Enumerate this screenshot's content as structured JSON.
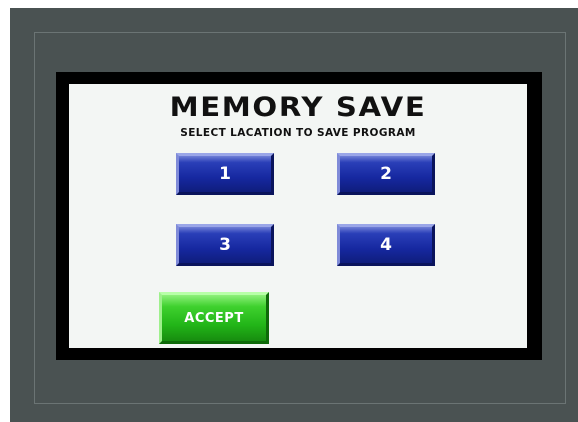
{
  "screen": {
    "title": "MEMORY SAVE",
    "subtitle": "SELECT LACATION TO SAVE PROGRAM"
  },
  "slots": [
    {
      "label": "1"
    },
    {
      "label": "2"
    },
    {
      "label": "3"
    },
    {
      "label": "4"
    }
  ],
  "actions": {
    "accept_label": "ACCEPT"
  },
  "colors": {
    "bezel": "#4a5252",
    "screen_background": "#f3f6f4",
    "slot_button": "#1628a0",
    "accept_button": "#22b518"
  }
}
